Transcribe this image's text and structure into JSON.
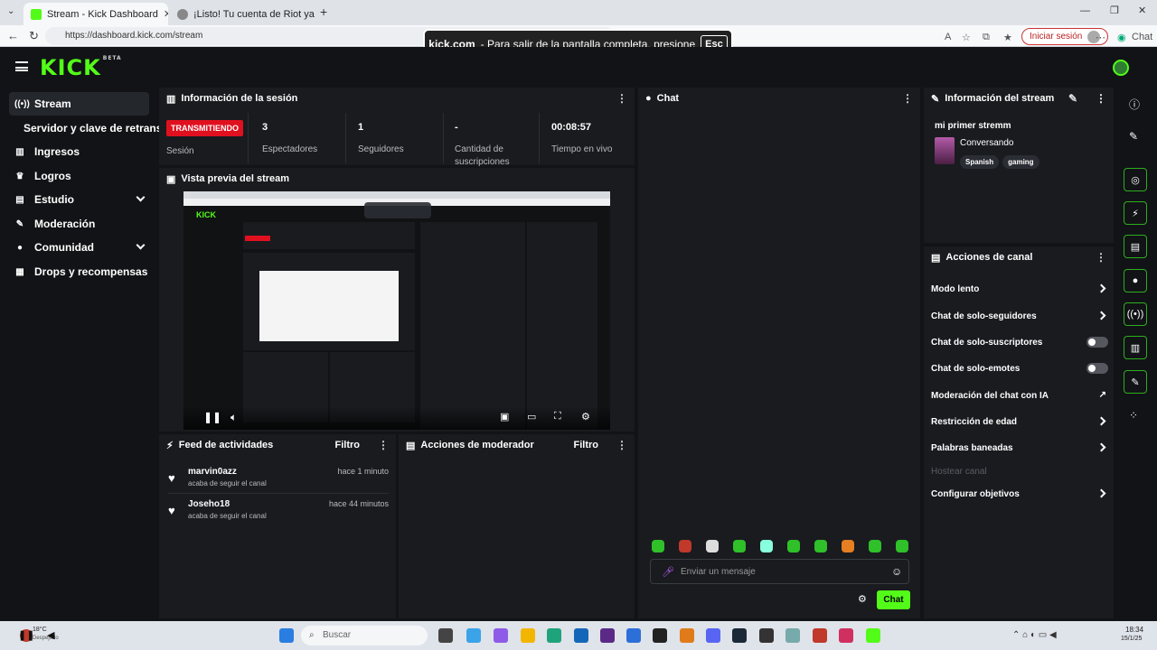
{
  "browser": {
    "tabs": [
      {
        "title": "Stream - Kick Dashboard",
        "favicon_color": "#53fc18"
      },
      {
        "title": "¡Listo! Tu cuenta de Riot ya está c",
        "favicon_color": "#888888"
      }
    ],
    "url": "https://dashboard.kick.com/stream",
    "fullscreen_notice": {
      "site": "kick.com",
      "message": "-  Para salir de la pantalla completa, presione",
      "key": "Esc"
    },
    "signin_label": "Iniciar sesión",
    "chat_label": "Chat"
  },
  "app": {
    "logo": "KICK",
    "logo_badge": "BETA",
    "accent_color": "#53fc18",
    "live_color": "#e0101f"
  },
  "sidebar": {
    "items": [
      {
        "label": "Stream",
        "icon": "stream-icon",
        "active": true
      },
      {
        "label": "Servidor y clave de retransm",
        "icon": "",
        "active": false
      },
      {
        "label": "Ingresos",
        "icon": "chart-icon",
        "active": false
      },
      {
        "label": "Logros",
        "icon": "trophy-icon",
        "active": false
      },
      {
        "label": "Estudio",
        "icon": "studio-icon",
        "active": false,
        "expandable": true
      },
      {
        "label": "Moderación",
        "icon": "wrench-icon",
        "active": false
      },
      {
        "label": "Comunidad",
        "icon": "community-icon",
        "active": false,
        "expandable": true
      },
      {
        "label": "Drops y recompensas",
        "icon": "gift-icon",
        "active": false
      }
    ]
  },
  "session": {
    "title": "Información de la sesión",
    "status_badge": "TRANSMITIENDO",
    "status_label": "Sesión",
    "stats": [
      {
        "value": "3",
        "label": "Espectadores"
      },
      {
        "value": "1",
        "label": "Seguidores"
      },
      {
        "value": "-",
        "label": "Cantidad de suscripciones"
      },
      {
        "value": "00:08:57",
        "label": "Tiempo en vivo"
      }
    ]
  },
  "preview": {
    "title": "Vista previa del stream"
  },
  "feed": {
    "title": "Feed de actividades",
    "filter": "Filtro",
    "items": [
      {
        "name": "marvin0azz",
        "action": "acaba de seguir el canal",
        "time": "hace 1 minuto"
      },
      {
        "name": "Joseho18",
        "action": "acaba de seguir el canal",
        "time": "hace 44 minutos"
      }
    ]
  },
  "mod_actions": {
    "title": "Acciones de moderador",
    "filter": "Filtro"
  },
  "chat": {
    "title": "Chat",
    "placeholder": "Enviar un mensaje",
    "send_label": "Chat"
  },
  "stream_info": {
    "title": "Información del stream",
    "stream_title": "mi primer stremm",
    "category": "Conversando",
    "tags": [
      "Spanish",
      "gaming"
    ]
  },
  "channel_actions": {
    "title": "Acciones de canal",
    "items": [
      {
        "label": "Modo lento",
        "control": "chevron"
      },
      {
        "label": "Chat de solo-seguidores",
        "control": "chevron"
      },
      {
        "label": "Chat de solo-suscriptores",
        "control": "toggle"
      },
      {
        "label": "Chat de solo-emotes",
        "control": "toggle"
      },
      {
        "label": "Moderación del chat con IA",
        "control": "external"
      },
      {
        "label": "Restricción de edad",
        "control": "chevron"
      },
      {
        "label": "Palabras baneadas",
        "control": "chevron"
      },
      {
        "label": "Hostear canal",
        "control": "none",
        "disabled": true
      },
      {
        "label": "Configurar objetivos",
        "control": "chevron"
      }
    ]
  },
  "taskbar": {
    "weather": "18°C",
    "weather_sub": "Despejado",
    "search": "Buscar",
    "time": "18:34",
    "date": "15/1/25"
  }
}
